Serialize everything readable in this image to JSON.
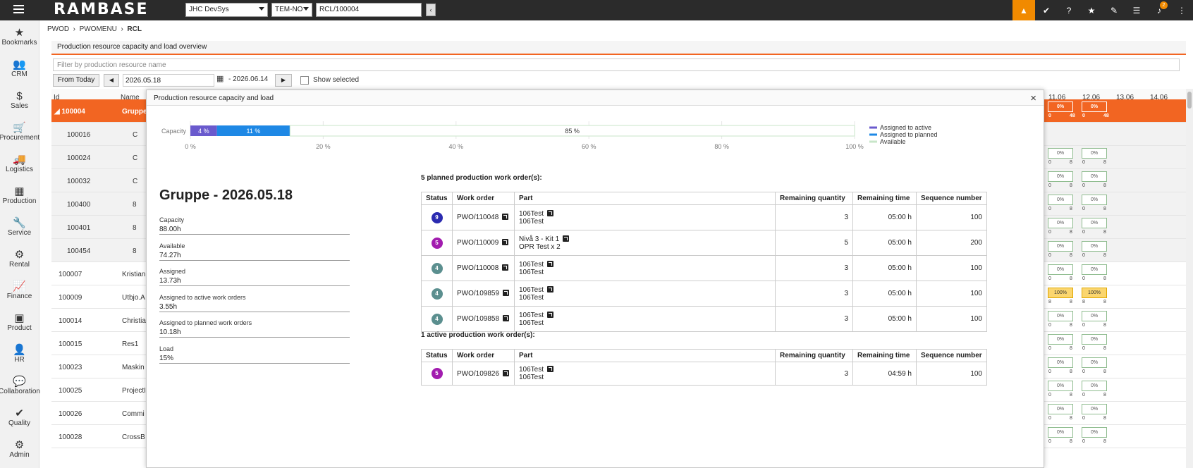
{
  "topbar": {
    "logo": "RAMBASE",
    "company": "JHC DevSys",
    "locale": "TEM-NO",
    "doc_input": "RCL/100004",
    "back": "‹",
    "notification_count": "2",
    "icons": [
      "warning-icon",
      "check-circle-icon",
      "help-icon",
      "star-icon",
      "clip-icon",
      "list-icon",
      "bell-icon"
    ]
  },
  "sidebar": [
    {
      "label": "Bookmarks",
      "icon": "★"
    },
    {
      "label": "CRM",
      "icon": "👥"
    },
    {
      "label": "Sales",
      "icon": "$"
    },
    {
      "label": "Procurement",
      "icon": "🛒"
    },
    {
      "label": "Logistics",
      "icon": "🚚"
    },
    {
      "label": "Production",
      "icon": "▦"
    },
    {
      "label": "Service",
      "icon": "🔧"
    },
    {
      "label": "Rental",
      "icon": "⚙"
    },
    {
      "label": "Finance",
      "icon": "📈"
    },
    {
      "label": "Product",
      "icon": "▣"
    },
    {
      "label": "HR",
      "icon": "👤"
    },
    {
      "label": "Collaboration",
      "icon": "💬"
    },
    {
      "label": "Quality",
      "icon": "✔"
    },
    {
      "label": "Admin",
      "icon": "⚙"
    }
  ],
  "breadcrumb": {
    "a": "PWOD",
    "b": "PWOMENU",
    "c": "RCL",
    "sep": "›"
  },
  "panel": {
    "title": "Production resource capacity and load overview",
    "filter_placeholder": "Filter by production resource name",
    "from_today": "From Today",
    "prev": "◀",
    "next": "▶",
    "from_date": "2026.05.18",
    "to_date": "- 2026.06.14",
    "show_selected": "Show selected"
  },
  "grid": {
    "col_id": "Id",
    "col_name": "Name",
    "date_cols": [
      "11.06",
      "12.06",
      "13.06",
      "14.06"
    ],
    "rows": [
      {
        "id": "◢ 100004",
        "name": "Gruppe",
        "c1": {
          "pct": "0%",
          "lo": "0",
          "hi": "48"
        },
        "c2": {
          "pct": "0%",
          "lo": "0",
          "hi": "48"
        }
      },
      {
        "id": "100016",
        "name": "C",
        "c1": null,
        "c2": null
      },
      {
        "id": "100024",
        "name": "C",
        "c1": {
          "pct": "0%",
          "lo": "0",
          "hi": "8"
        },
        "c2": {
          "pct": "0%",
          "lo": "0",
          "hi": "8"
        }
      },
      {
        "id": "100032",
        "name": "C",
        "c1": {
          "pct": "0%",
          "lo": "0",
          "hi": "8"
        },
        "c2": {
          "pct": "0%",
          "lo": "0",
          "hi": "8"
        }
      },
      {
        "id": "100400",
        "name": "8",
        "c1": {
          "pct": "0%",
          "lo": "0",
          "hi": "8"
        },
        "c2": {
          "pct": "0%",
          "lo": "0",
          "hi": "8"
        }
      },
      {
        "id": "100401",
        "name": "8",
        "c1": {
          "pct": "0%",
          "lo": "0",
          "hi": "8"
        },
        "c2": {
          "pct": "0%",
          "lo": "0",
          "hi": "8"
        }
      },
      {
        "id": "100454",
        "name": "8",
        "c1": {
          "pct": "0%",
          "lo": "0",
          "hi": "8"
        },
        "c2": {
          "pct": "0%",
          "lo": "0",
          "hi": "8"
        }
      },
      {
        "id": "100007",
        "name": "Kristian",
        "c1": {
          "pct": "0%",
          "lo": "0",
          "hi": "8"
        },
        "c2": {
          "pct": "0%",
          "lo": "0",
          "hi": "8"
        }
      },
      {
        "id": "100009",
        "name": "Utbjo.A",
        "c1": {
          "pct": "100%",
          "lo": "8",
          "hi": "8"
        },
        "c2": {
          "pct": "100%",
          "lo": "8",
          "hi": "8"
        }
      },
      {
        "id": "100014",
        "name": "Christia",
        "c1": {
          "pct": "0%",
          "lo": "0",
          "hi": "8"
        },
        "c2": {
          "pct": "0%",
          "lo": "0",
          "hi": "8"
        }
      },
      {
        "id": "100015",
        "name": "Res1",
        "c1": {
          "pct": "0%",
          "lo": "0",
          "hi": "8"
        },
        "c2": {
          "pct": "0%",
          "lo": "0",
          "hi": "8"
        }
      },
      {
        "id": "100023",
        "name": "Maskin",
        "c1": {
          "pct": "0%",
          "lo": "0",
          "hi": "8"
        },
        "c2": {
          "pct": "0%",
          "lo": "0",
          "hi": "8"
        }
      },
      {
        "id": "100025",
        "name": "ProjectI",
        "c1": {
          "pct": "0%",
          "lo": "0",
          "hi": "8"
        },
        "c2": {
          "pct": "0%",
          "lo": "0",
          "hi": "8"
        }
      },
      {
        "id": "100026",
        "name": "Commi",
        "c1": {
          "pct": "0%",
          "lo": "0",
          "hi": "8"
        },
        "c2": {
          "pct": "0%",
          "lo": "0",
          "hi": "8"
        }
      },
      {
        "id": "100028",
        "name": "CrossB",
        "c1": {
          "pct": "0%",
          "lo": "0",
          "hi": "8"
        },
        "c2": {
          "pct": "0%",
          "lo": "0",
          "hi": "8"
        }
      }
    ]
  },
  "modal": {
    "title": "Production resource capacity and load",
    "close": "×",
    "heading": "Gruppe - 2026.05.18",
    "stats": [
      {
        "label": "Capacity",
        "value": "88.00h"
      },
      {
        "label": "Available",
        "value": "74.27h"
      },
      {
        "label": "Assigned",
        "value": "13.73h"
      },
      {
        "label": "Assigned to active work orders",
        "value": "3.55h"
      },
      {
        "label": "Assigned to planned work orders",
        "value": "10.18h"
      },
      {
        "label": "Load",
        "value": "15%"
      }
    ],
    "planned_title": "5 planned production work order(s):",
    "active_title": "1 active production work order(s):",
    "columns": [
      "Status",
      "Work order",
      "Part",
      "Remaining quantity",
      "Remaining time",
      "Sequence number"
    ],
    "planned": [
      {
        "status": "9",
        "color": "#2b2bb0",
        "wo": "PWO/110048",
        "part1": "106Test",
        "part2": "106Test",
        "qty": "3",
        "time": "05:00 h",
        "seq": "100"
      },
      {
        "status": "5",
        "color": "#a21caf",
        "wo": "PWO/110009",
        "part1": "Nivå 3 - Kit 1",
        "part2": "OPR Test x 2",
        "qty": "5",
        "time": "05:00 h",
        "seq": "200"
      },
      {
        "status": "4",
        "color": "#5b8f8f",
        "wo": "PWO/110008",
        "part1": "106Test",
        "part2": "106Test",
        "qty": "3",
        "time": "05:00 h",
        "seq": "100"
      },
      {
        "status": "4",
        "color": "#5b8f8f",
        "wo": "PWO/109859",
        "part1": "106Test",
        "part2": "106Test",
        "qty": "3",
        "time": "05:00 h",
        "seq": "100"
      },
      {
        "status": "4",
        "color": "#5b8f8f",
        "wo": "PWO/109858",
        "part1": "106Test",
        "part2": "106Test",
        "qty": "3",
        "time": "05:00 h",
        "seq": "100"
      }
    ],
    "active": [
      {
        "status": "5",
        "color": "#a21caf",
        "wo": "PWO/109826",
        "part1": "106Test",
        "part2": "106Test",
        "qty": "3",
        "time": "04:59 h",
        "seq": "100"
      }
    ]
  },
  "chart_data": {
    "type": "bar",
    "orientation": "horizontal-stacked",
    "categories": [
      "Capacity"
    ],
    "series": [
      {
        "name": "Assigned to active",
        "values": [
          4
        ],
        "label": "4 %",
        "color": "#6a5acd"
      },
      {
        "name": "Assigned to planned",
        "values": [
          11
        ],
        "label": "11 %",
        "color": "#1e88e5"
      },
      {
        "name": "Available",
        "values": [
          85
        ],
        "label": "85 %",
        "color": "#c8e6c9"
      }
    ],
    "xticks": [
      "0 %",
      "20 %",
      "40 %",
      "60 %",
      "80 %",
      "100 %"
    ],
    "xlim": [
      0,
      100
    ],
    "legend": "right"
  }
}
